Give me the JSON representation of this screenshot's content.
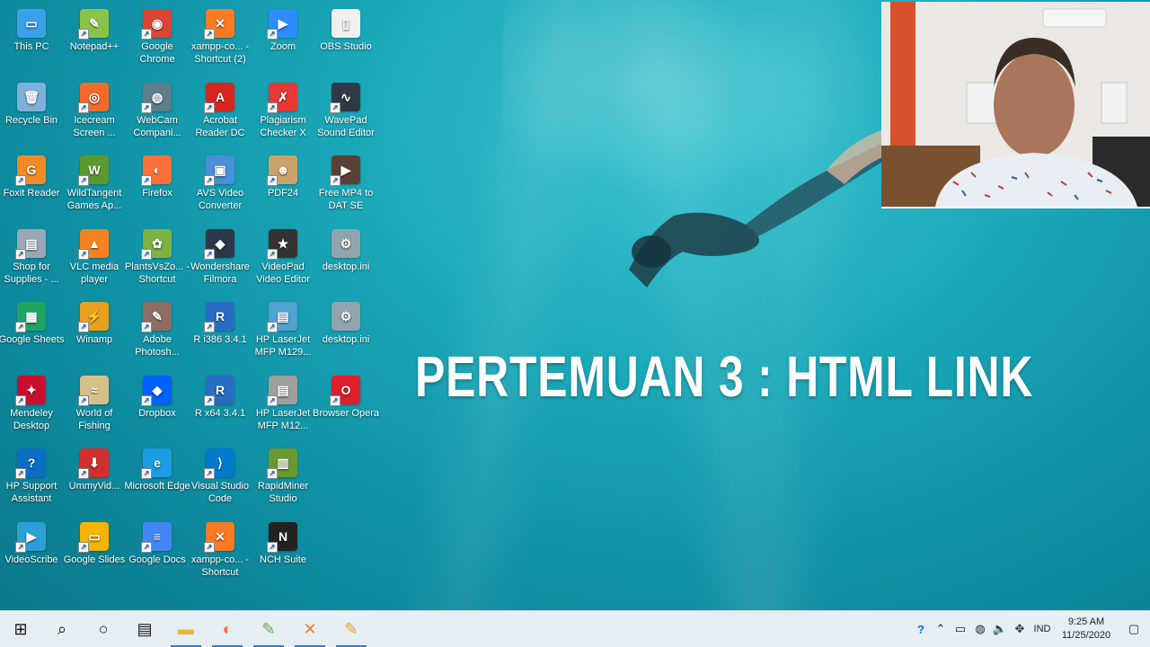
{
  "desktop": {
    "headline": "PERTEMUAN 3 : HTML LINK",
    "icons": [
      {
        "label": "This PC",
        "color": "#3aa0e8",
        "glyph": "▭",
        "shortcut": false
      },
      {
        "label": "Recycle Bin",
        "color": "#7fb0d8",
        "glyph": "🗑",
        "shortcut": false
      },
      {
        "label": "Foxit Reader",
        "color": "#f08a24",
        "glyph": "G",
        "shortcut": true
      },
      {
        "label": "Shop for Supplies - ...",
        "color": "#9aa7b5",
        "glyph": "▤",
        "shortcut": true
      },
      {
        "label": "Google Sheets",
        "color": "#1fa463",
        "glyph": "▦",
        "shortcut": true
      },
      {
        "label": "Mendeley Desktop",
        "color": "#c8102e",
        "glyph": "✦",
        "shortcut": true
      },
      {
        "label": "HP Support Assistant",
        "color": "#0a6fc2",
        "glyph": "?",
        "shortcut": true
      },
      {
        "label": "VideoScribe",
        "color": "#2b9fd6",
        "glyph": "▶",
        "shortcut": true
      },
      {
        "label": "Notepad++",
        "color": "#8bc34a",
        "glyph": "✎",
        "shortcut": true
      },
      {
        "label": "Icecream Screen ...",
        "color": "#f26b2a",
        "glyph": "◎",
        "shortcut": true
      },
      {
        "label": "WildTangent Games Ap...",
        "color": "#5c9a2e",
        "glyph": "W",
        "shortcut": true
      },
      {
        "label": "VLC media player",
        "color": "#f5821f",
        "glyph": "▲",
        "shortcut": true
      },
      {
        "label": "Winamp",
        "color": "#e8a020",
        "glyph": "⚡",
        "shortcut": true
      },
      {
        "label": "World of Fishing",
        "color": "#d6c08a",
        "glyph": "≈",
        "shortcut": true
      },
      {
        "label": "UmmyVid...",
        "color": "#d32f2f",
        "glyph": "⬇",
        "shortcut": true
      },
      {
        "label": "Google Slides",
        "color": "#f4b400",
        "glyph": "▭",
        "shortcut": true
      },
      {
        "label": "Google Chrome",
        "color": "#db4437",
        "glyph": "◉",
        "shortcut": true
      },
      {
        "label": "WebCam Compani...",
        "color": "#607d8b",
        "glyph": "◍",
        "shortcut": true
      },
      {
        "label": "Firefox",
        "color": "#ff7139",
        "glyph": "◐",
        "shortcut": true
      },
      {
        "label": "PlantsVsZo... - Shortcut",
        "color": "#7cb342",
        "glyph": "✿",
        "shortcut": true
      },
      {
        "label": "Adobe Photosh...",
        "color": "#8d6e63",
        "glyph": "✎",
        "shortcut": true
      },
      {
        "label": "Dropbox",
        "color": "#0061ff",
        "glyph": "◆",
        "shortcut": true
      },
      {
        "label": "Microsoft Edge",
        "color": "#1b9de2",
        "glyph": "e",
        "shortcut": true
      },
      {
        "label": "Google Docs",
        "color": "#4285f4",
        "glyph": "≡",
        "shortcut": true
      },
      {
        "label": "xampp-co... - Shortcut (2)",
        "color": "#fb7a24",
        "glyph": "✕",
        "shortcut": true
      },
      {
        "label": "Acrobat Reader DC",
        "color": "#d7261d",
        "glyph": "A",
        "shortcut": true
      },
      {
        "label": "AVS Video Converter",
        "color": "#4a90d9",
        "glyph": "▣",
        "shortcut": true
      },
      {
        "label": "Wondershare Filmora",
        "color": "#2d3748",
        "glyph": "◆",
        "shortcut": true
      },
      {
        "label": "R i386 3.4.1",
        "color": "#276dc3",
        "glyph": "R",
        "shortcut": true
      },
      {
        "label": "R x64 3.4.1",
        "color": "#276dc3",
        "glyph": "R",
        "shortcut": true
      },
      {
        "label": "Visual Studio Code",
        "color": "#007acc",
        "glyph": "⟩",
        "shortcut": true
      },
      {
        "label": "xampp-co... - Shortcut",
        "color": "#fb7a24",
        "glyph": "✕",
        "shortcut": true
      },
      {
        "label": "Zoom",
        "color": "#2d8cff",
        "glyph": "▶",
        "shortcut": true
      },
      {
        "label": "Plagiarism Checker X",
        "color": "#e53935",
        "glyph": "✗",
        "shortcut": true
      },
      {
        "label": "PDF24",
        "color": "#c9a36a",
        "glyph": "☻",
        "shortcut": true
      },
      {
        "label": "VideoPad Video Editor",
        "color": "#333333",
        "glyph": "★",
        "shortcut": true
      },
      {
        "label": "HP LaserJet MFP M129...",
        "color": "#4fa3d1",
        "glyph": "▤",
        "shortcut": true
      },
      {
        "label": "HP LaserJet MFP M12...",
        "color": "#9e9e9e",
        "glyph": "▤",
        "shortcut": true
      },
      {
        "label": "RapidMiner Studio",
        "color": "#6a9a2f",
        "glyph": "▥",
        "shortcut": true
      },
      {
        "label": "NCH Suite",
        "color": "#222222",
        "glyph": "N",
        "shortcut": true
      },
      {
        "label": "OBS Studio",
        "color": "#f0f0f0",
        "glyph": "▯",
        "shortcut": false
      },
      {
        "label": "WavePad Sound Editor",
        "color": "#2f3a46",
        "glyph": "∿",
        "shortcut": true
      },
      {
        "label": "Free MP4 to DAT SE",
        "color": "#5d4037",
        "glyph": "▶",
        "shortcut": true
      },
      {
        "label": "desktop.ini",
        "color": "#90a4ae",
        "glyph": "⚙",
        "shortcut": false
      },
      {
        "label": "desktop.ini",
        "color": "#90a4ae",
        "glyph": "⚙",
        "shortcut": false
      },
      {
        "label": "Browser Opera",
        "color": "#e01e2c",
        "glyph": "O",
        "shortcut": true
      }
    ]
  },
  "taskbar": {
    "pinned": [
      {
        "name": "start",
        "glyph": "⊞",
        "color": "#111111"
      },
      {
        "name": "search",
        "glyph": "⌕",
        "color": "#111111"
      },
      {
        "name": "cortana",
        "glyph": "○",
        "color": "#111111"
      },
      {
        "name": "task-view",
        "glyph": "▤",
        "color": "#111111"
      },
      {
        "name": "file-explorer",
        "glyph": "▬",
        "color": "#e8b23a"
      },
      {
        "name": "firefox",
        "glyph": "◐",
        "color": "#ff7139"
      },
      {
        "name": "notepad-plus",
        "glyph": "✎",
        "color": "#6aa84f"
      },
      {
        "name": "xampp",
        "glyph": "✕",
        "color": "#fb7a24"
      },
      {
        "name": "notepad-plus-2",
        "glyph": "✎",
        "color": "#e8a020"
      }
    ],
    "tray": {
      "language": "IND",
      "time": "9:25 AM",
      "date": "11/25/2020"
    }
  }
}
